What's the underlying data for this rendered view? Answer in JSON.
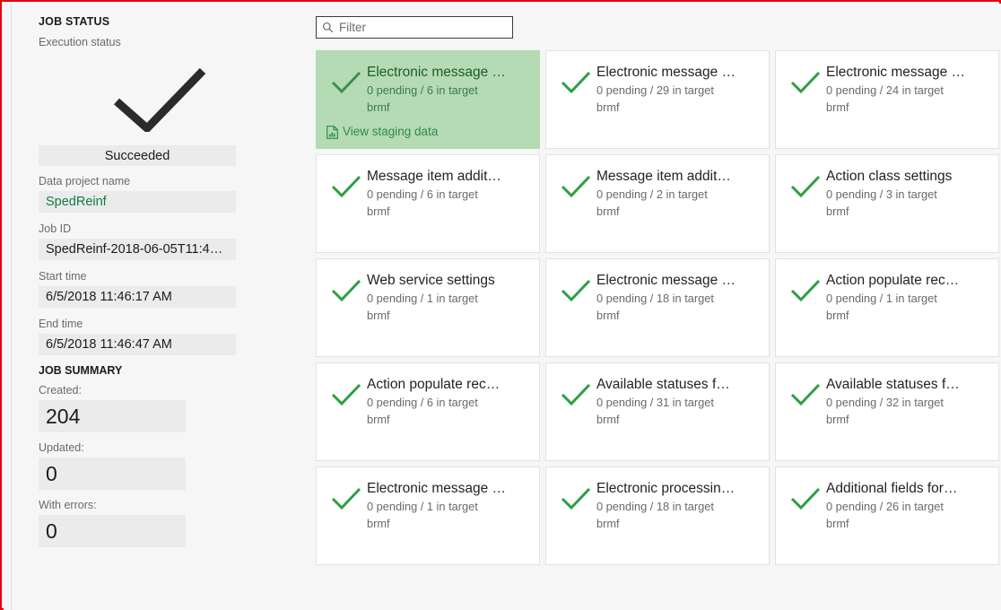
{
  "status_pane": {
    "heading": "JOB STATUS",
    "execution_status_label": "Execution status",
    "status_icon": "checkmark-icon",
    "status_value": "Succeeded",
    "data_project_name_label": "Data project name",
    "data_project_name_value": "SpedReinf",
    "job_id_label": "Job ID",
    "job_id_value": "SpedReinf-2018-06-05T11:4…",
    "start_time_label": "Start time",
    "start_time_value": "6/5/2018 11:46:17 AM",
    "end_time_label": "End time",
    "end_time_value": "6/5/2018 11:46:47 AM",
    "summary_heading": "JOB SUMMARY",
    "created_label": "Created:",
    "created_value": "204",
    "updated_label": "Updated:",
    "updated_value": "0",
    "errors_label": "With errors:",
    "errors_value": "0"
  },
  "filter": {
    "icon": "search-icon",
    "placeholder": "Filter",
    "value": ""
  },
  "cards": [
    {
      "status_icon": "checkmark-icon",
      "title": "Electronic message …",
      "counts": "0 pending / 6 in target",
      "entity": "brmf",
      "highlighted": true,
      "action_icon": "staging-document-icon",
      "action_label": "View staging data"
    },
    {
      "status_icon": "checkmark-icon",
      "title": "Electronic message …",
      "counts": "0 pending / 29 in target",
      "entity": "brmf",
      "highlighted": false
    },
    {
      "status_icon": "checkmark-icon",
      "title": "Electronic message …",
      "counts": "0 pending / 24 in target",
      "entity": "brmf",
      "highlighted": false
    },
    {
      "status_icon": "checkmark-icon",
      "title": "Message item addit…",
      "counts": "0 pending / 6 in target",
      "entity": "brmf",
      "highlighted": false
    },
    {
      "status_icon": "checkmark-icon",
      "title": "Message item addit…",
      "counts": "0 pending / 2 in target",
      "entity": "brmf",
      "highlighted": false
    },
    {
      "status_icon": "checkmark-icon",
      "title": "Action class settings",
      "counts": "0 pending / 3 in target",
      "entity": "brmf",
      "highlighted": false
    },
    {
      "status_icon": "checkmark-icon",
      "title": "Web service settings",
      "counts": "0 pending / 1 in target",
      "entity": "brmf",
      "highlighted": false
    },
    {
      "status_icon": "checkmark-icon",
      "title": "Electronic message …",
      "counts": "0 pending / 18 in target",
      "entity": "brmf",
      "highlighted": false
    },
    {
      "status_icon": "checkmark-icon",
      "title": "Action populate rec…",
      "counts": "0 pending / 1 in target",
      "entity": "brmf",
      "highlighted": false
    },
    {
      "status_icon": "checkmark-icon",
      "title": "Action populate rec…",
      "counts": "0 pending / 6 in target",
      "entity": "brmf",
      "highlighted": false
    },
    {
      "status_icon": "checkmark-icon",
      "title": "Available statuses f…",
      "counts": "0 pending / 31 in target",
      "entity": "brmf",
      "highlighted": false
    },
    {
      "status_icon": "checkmark-icon",
      "title": "Available statuses f…",
      "counts": "0 pending / 32 in target",
      "entity": "brmf",
      "highlighted": false
    },
    {
      "status_icon": "checkmark-icon",
      "title": "Electronic message …",
      "counts": "0 pending / 1 in target",
      "entity": "brmf",
      "highlighted": false
    },
    {
      "status_icon": "checkmark-icon",
      "title": "Electronic processin…",
      "counts": "0 pending / 18 in target",
      "entity": "brmf",
      "highlighted": false
    },
    {
      "status_icon": "checkmark-icon",
      "title": "Additional fields for…",
      "counts": "0 pending / 26 in target",
      "entity": "brmf",
      "highlighted": false
    }
  ],
  "colors": {
    "accent_green": "#2e9e44",
    "highlight_green": "#b4dbb4",
    "link_green": "#107c41",
    "frame_red": "#e8000d",
    "page_background": "#f6f6f6",
    "field_background": "#ebebeb"
  }
}
